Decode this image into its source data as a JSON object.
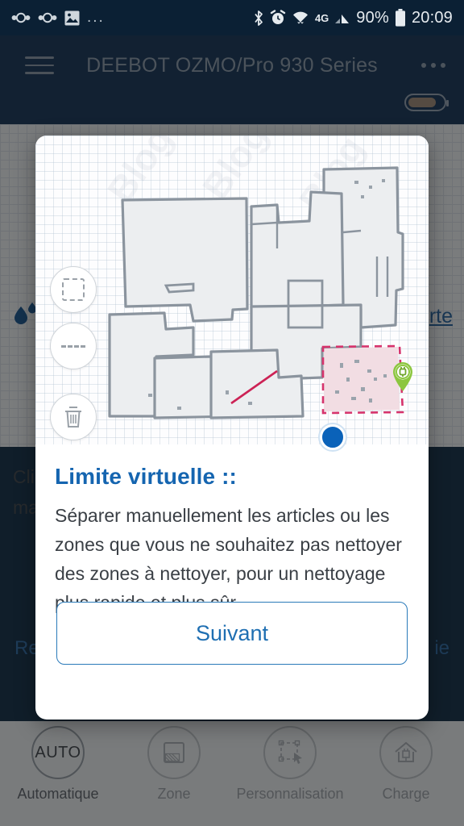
{
  "status_bar": {
    "left_icons": [
      "nextcloud-sync-icon",
      "nextcloud-sync-icon",
      "gallery-image-icon",
      "more-notifications-icon"
    ],
    "more_glyph": "...",
    "right_icons": [
      "bluetooth-icon",
      "alarm-clock-icon",
      "wifi-icon",
      "mobile-data-4g-icon",
      "cell-signal-icon",
      "battery-icon"
    ],
    "data_label": "4G",
    "battery_percent": "90%",
    "clock": "20:09"
  },
  "app_bar": {
    "menu_icon": "hamburger-menu-icon",
    "title": "DEEBOT OZMO/Pro 930 Series",
    "overflow_icon": "kebab-menu-icon",
    "battery_indicator": "robot-battery-icon"
  },
  "background": {
    "water_icon": "water-drops-icon",
    "map_link": "rte",
    "hint_line1": "Cliqu",
    "hint_line2": "main",
    "left_link": "Re",
    "right_link": "ie",
    "watermark": "Blog Domotique"
  },
  "modal": {
    "title": "Limite virtuelle ::",
    "body": "Séparer manuellement les articles ou les zones que vous ne souhaitez pas nettoyer des zones à nettoyer, pour un nettoyage plus rapide et plus sûr.",
    "next_label": "Suivant",
    "map": {
      "tools": [
        {
          "name": "virtual-zone-tool",
          "icon": "dashed-square-icon"
        },
        {
          "name": "virtual-boundary-tool",
          "icon": "dashed-line-icon"
        },
        {
          "name": "delete-tool",
          "icon": "trash-icon"
        }
      ],
      "robot_marker": "robot-position-icon",
      "dock_marker": "charging-dock-icon",
      "restricted_zone": "virtual-boundary-zone",
      "watermark": "Blog Domotique"
    },
    "colors": {
      "accent": "#1565b0",
      "button_border": "#2a7ab9",
      "robot": "#0a62b9",
      "dock": "#8cc63f",
      "zone_stroke": "#d6336c",
      "zone_fill": "#f2dde3"
    }
  },
  "bottom_nav": [
    {
      "name": "auto-clean",
      "icon": "auto-text-icon",
      "icon_text": "AUTO",
      "label": "Automatique"
    },
    {
      "name": "zone-clean",
      "icon": "zone-grid-icon",
      "label": "Zone"
    },
    {
      "name": "custom-clean",
      "icon": "custom-select-icon",
      "label": "Personnalisation"
    },
    {
      "name": "charge",
      "icon": "home-charge-icon",
      "label": "Charge"
    }
  ]
}
